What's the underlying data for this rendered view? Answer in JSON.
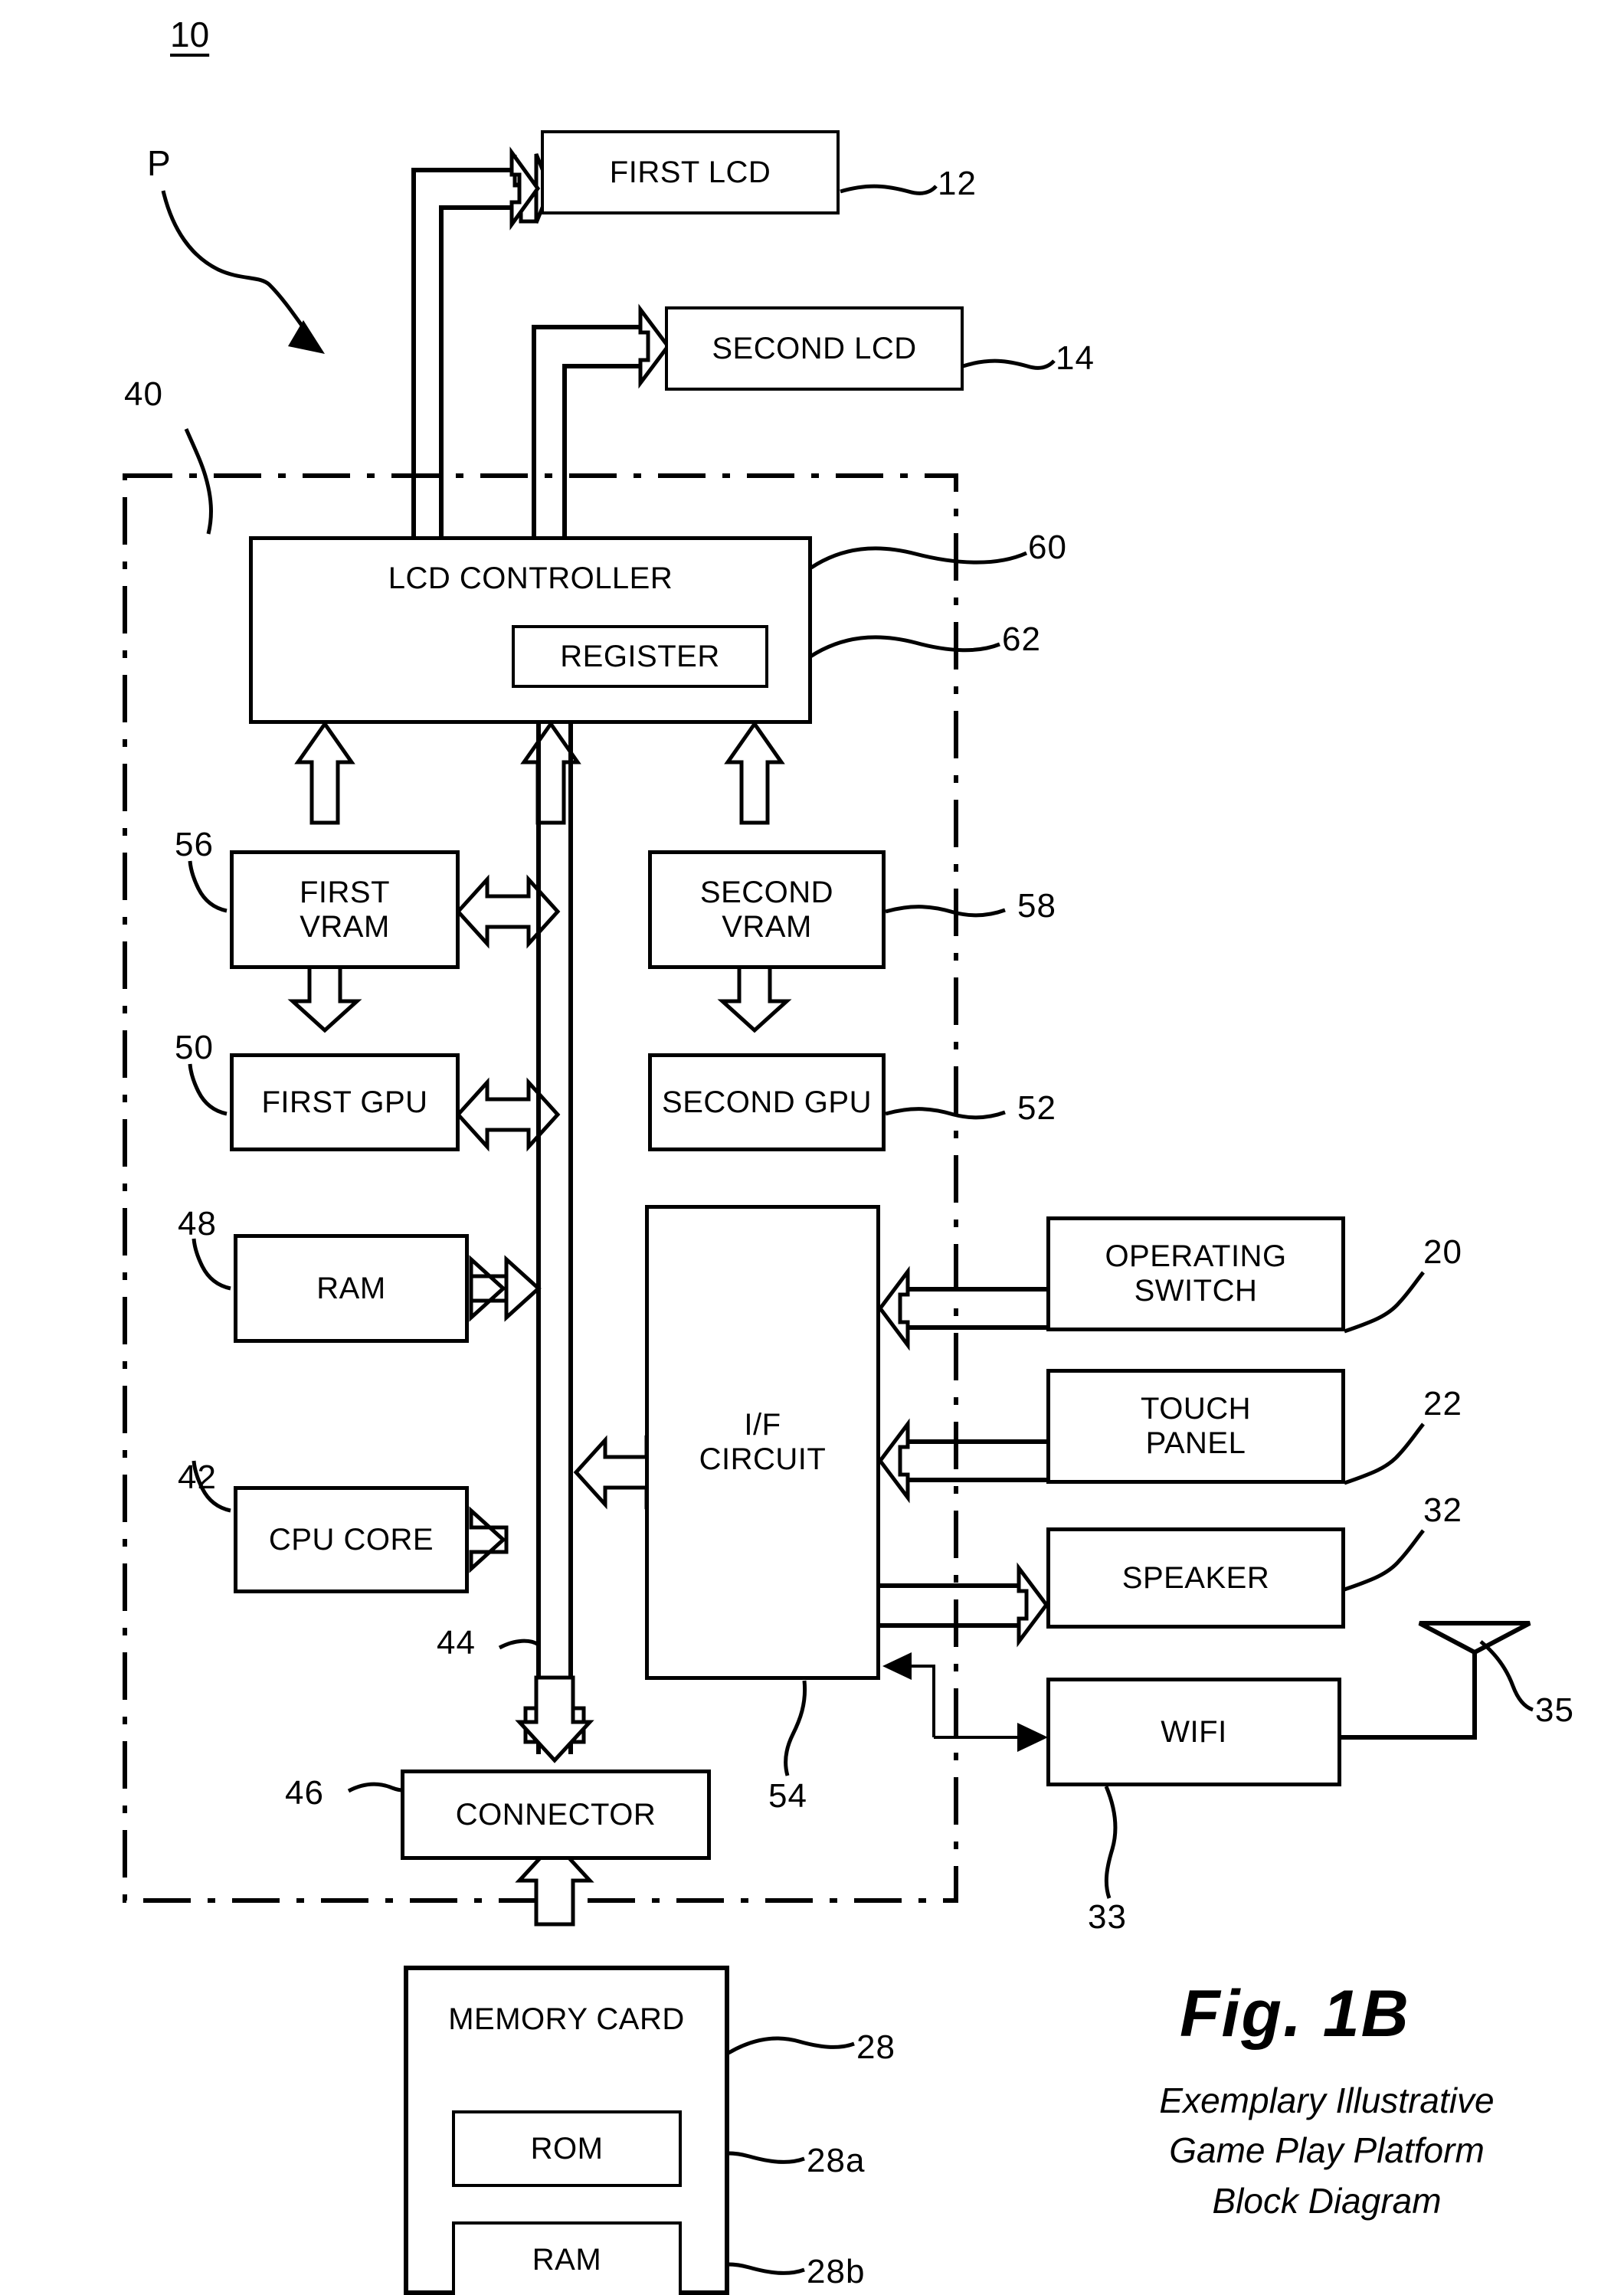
{
  "figure": {
    "top_numeral": "10",
    "platform_marker": "P",
    "title": "Fig. 1B",
    "subtitle_lines": [
      "Exemplary Illustrative",
      "Game Play Platform",
      "Block Diagram"
    ]
  },
  "blocks": {
    "first_lcd": {
      "label": "FIRST LCD",
      "ref": "12"
    },
    "second_lcd": {
      "label": "SECOND LCD",
      "ref": "14"
    },
    "lcd_controller": {
      "label": "LCD CONTROLLER",
      "ref": "60"
    },
    "register": {
      "label": "REGISTER",
      "ref": "62"
    },
    "first_vram": {
      "label": "FIRST\nVRAM",
      "label_line1": "FIRST",
      "label_line2": "VRAM",
      "ref": "56"
    },
    "second_vram": {
      "label": "SECOND\nVRAM",
      "label_line1": "SECOND",
      "label_line2": "VRAM",
      "ref": "58"
    },
    "first_gpu": {
      "label": "FIRST GPU",
      "ref": "50"
    },
    "second_gpu": {
      "label": "SECOND GPU",
      "ref": "52"
    },
    "ram": {
      "label": "RAM",
      "ref": "48"
    },
    "cpu_core": {
      "label": "CPU CORE",
      "ref": "42"
    },
    "if_circuit": {
      "label_line1": "I/F",
      "label_line2": "CIRCUIT",
      "ref": "54"
    },
    "operating_switch": {
      "label_line1": "OPERATING",
      "label_line2": "SWITCH",
      "ref": "20"
    },
    "touch_panel": {
      "label_line1": "TOUCH",
      "label_line2": "PANEL",
      "ref": "22"
    },
    "speaker": {
      "label": "SPEAKER",
      "ref": "32"
    },
    "wifi": {
      "label": "WIFI",
      "ref": "33"
    },
    "antenna": {
      "ref": "35"
    },
    "connector": {
      "label": "CONNECTOR",
      "ref": "46"
    },
    "memory_card": {
      "label": "MEMORY CARD",
      "ref": "28"
    },
    "card_rom": {
      "label": "ROM",
      "ref": "28a"
    },
    "card_ram": {
      "label": "RAM",
      "ref": "28b"
    },
    "bus": {
      "ref": "44"
    },
    "enclosure": {
      "ref": "40"
    }
  },
  "colors": {
    "line": "#000000",
    "background": "#ffffff"
  }
}
